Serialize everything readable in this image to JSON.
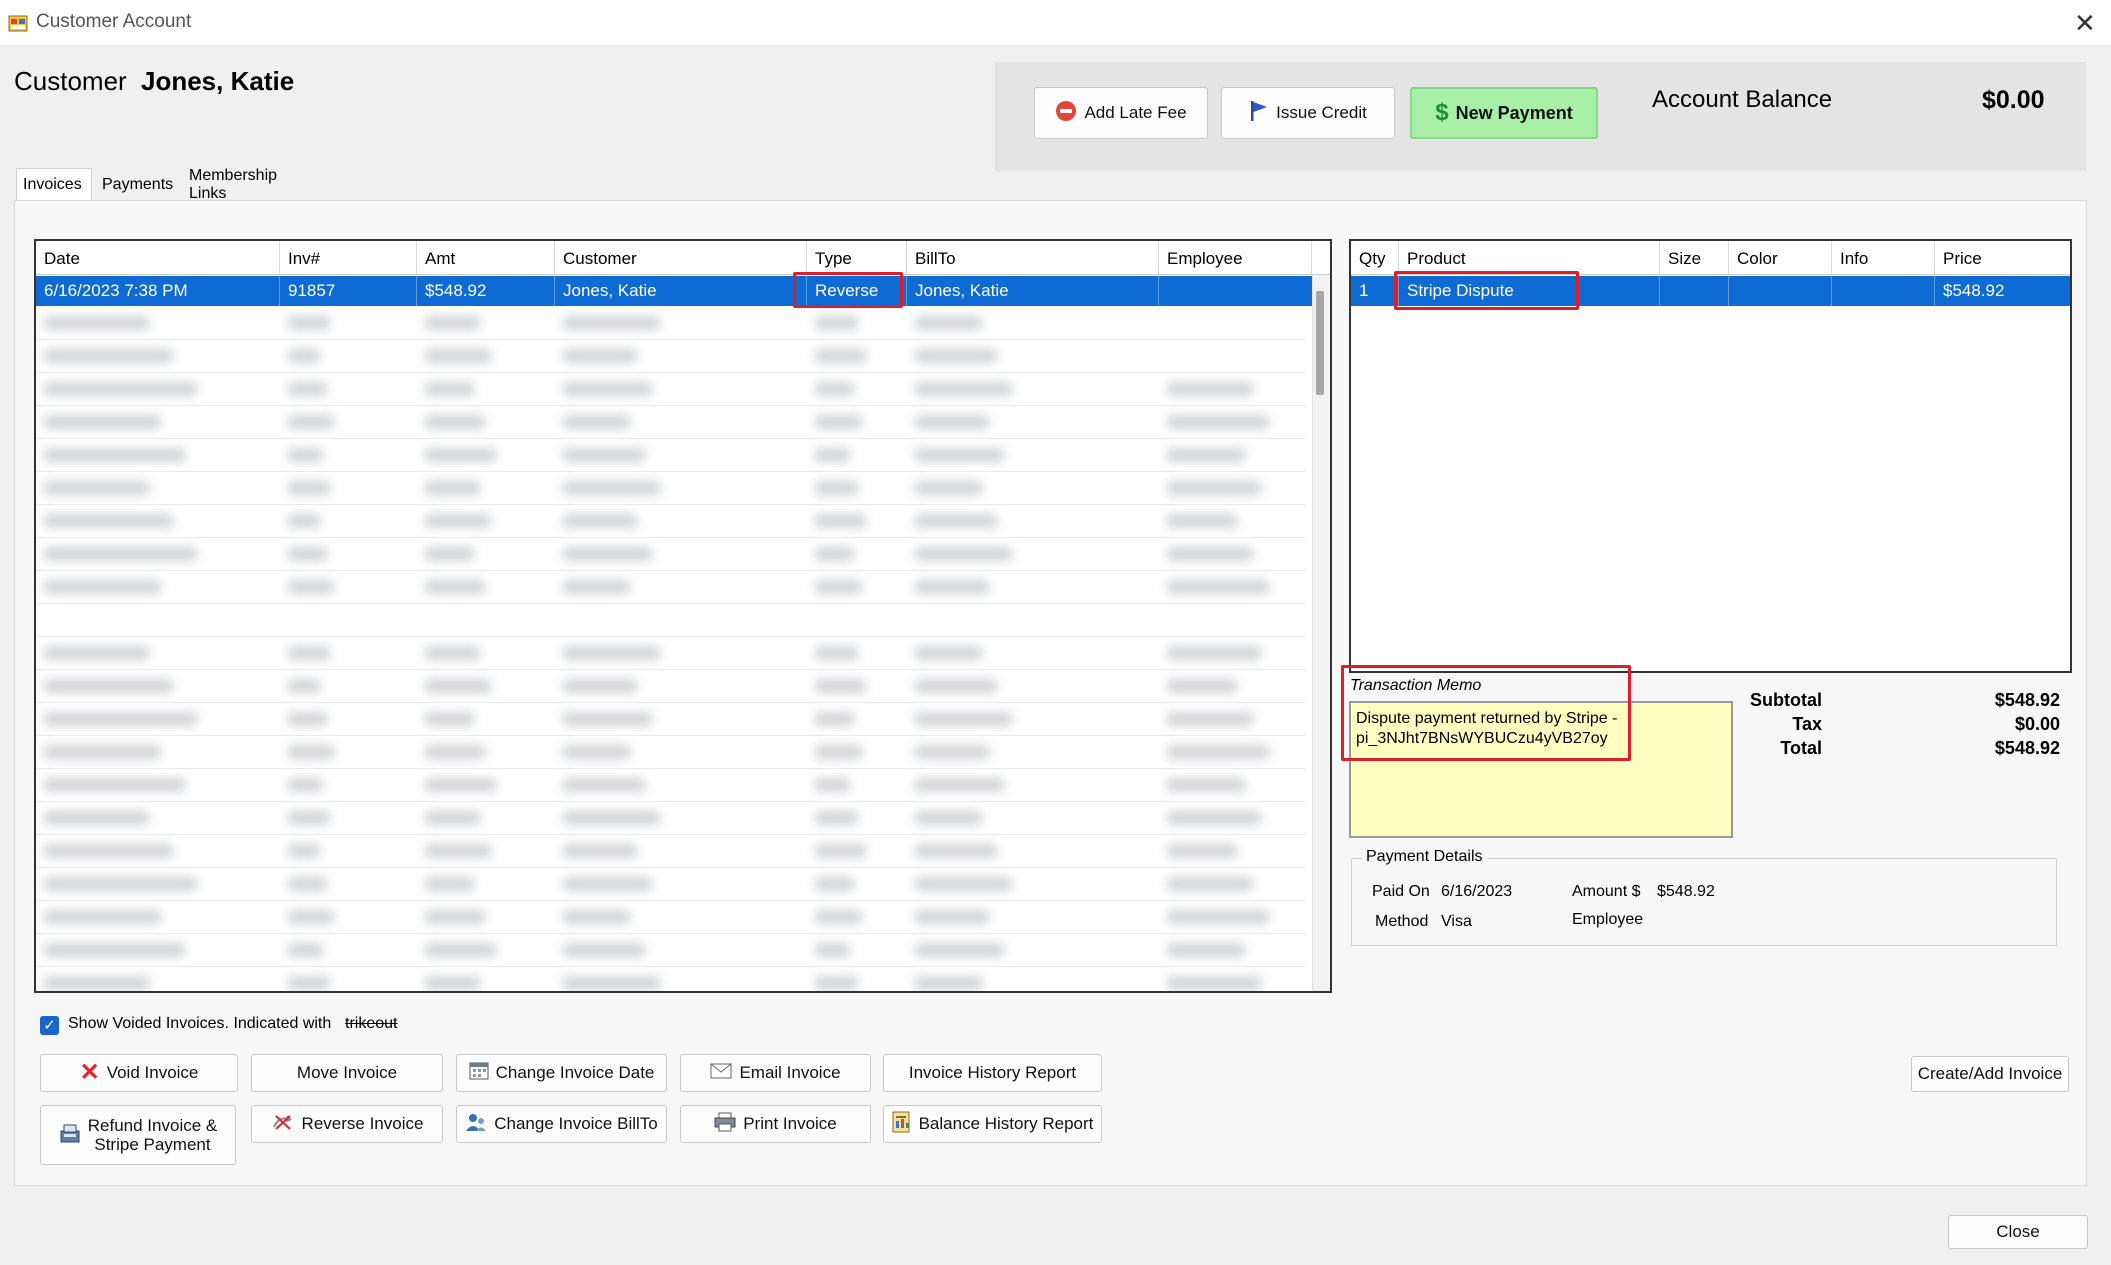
{
  "window": {
    "title": "Customer Account",
    "close_glyph": "✕"
  },
  "customer": {
    "label": "Customer",
    "name": "Jones, Katie"
  },
  "actions": {
    "add_late_fee": "Add Late Fee",
    "issue_credit": "Issue Credit",
    "new_payment": "New Payment",
    "new_payment_color": "#a8f0a8"
  },
  "balance": {
    "label": "Account Balance",
    "value": "$0.00"
  },
  "tabs": [
    "Invoices",
    "Payments",
    "Membership Links"
  ],
  "invoices": {
    "columns": [
      "Date",
      "Inv#",
      "Amt",
      "Customer",
      "Type",
      "BillTo",
      "Employee"
    ],
    "selected_row": {
      "date": "6/16/2023 7:38 PM",
      "inv": "91857",
      "amt": "$548.92",
      "customer": "Jones, Katie",
      "type": "Reverse",
      "billto": "Jones, Katie",
      "employee": ""
    },
    "selection_color": "#0e6bd3"
  },
  "products": {
    "columns": [
      "Qty",
      "Product",
      "Size",
      "Color",
      "Info",
      "Price"
    ],
    "selected_row": {
      "qty": "1",
      "product": "Stripe Dispute",
      "size": "",
      "color": "",
      "info": "",
      "price": "$548.92"
    }
  },
  "memo": {
    "label": "Transaction Memo",
    "line1": "Dispute payment returned by Stripe -",
    "line2": "pi_3NJht7BNsWYBUCzu4yVB27oy"
  },
  "totals": {
    "subtotal_label": "Subtotal",
    "subtotal": "$548.92",
    "tax_label": "Tax",
    "tax": "$0.00",
    "total_label": "Total",
    "total": "$548.92"
  },
  "payment_details": {
    "title": "Payment Details",
    "paid_on_label": "Paid On",
    "paid_on": "6/16/2023",
    "amount_label": "Amount $",
    "amount": "$548.92",
    "method_label": "Method",
    "method": "Visa",
    "employee_label": "Employee",
    "employee": ""
  },
  "options": {
    "show_voided": "Show Voided Invoices. Indicated with",
    "strikeout_sample": "trikeout",
    "show_voided_checked": true
  },
  "buttons": {
    "void_invoice": "Void Invoice",
    "move_invoice": "Move Invoice",
    "change_invoice_date": "Change Invoice Date",
    "email_invoice": "Email Invoice",
    "invoice_history_report": "Invoice History Report",
    "refund_line1": "Refund Invoice &",
    "refund_line2": "Stripe Payment",
    "reverse_invoice": "Reverse Invoice",
    "change_invoice_billto": "Change Invoice BillTo",
    "print_invoice": "Print Invoice",
    "balance_history_report": "Balance History Report",
    "create_add_invoice": "Create/Add Invoice",
    "close": "Close"
  }
}
